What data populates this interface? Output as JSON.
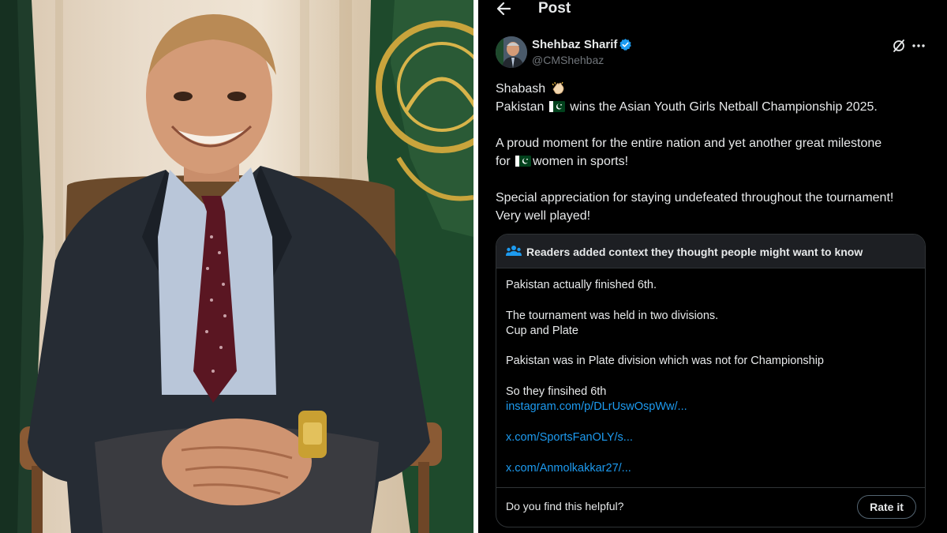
{
  "topbar": {
    "title": "Post"
  },
  "author": {
    "name": "Shehbaz Sharif",
    "handle": "@CMShehbaz"
  },
  "tweet": {
    "line1": "Shabash",
    "line2a": "Pakistan",
    "line2b": "wins the Asian Youth Girls Netball Championship 2025.",
    "line3": "A proud moment for the entire nation and yet another great milestone",
    "line4a": "for",
    "line4b": "women in sports!",
    "line5": "Special appreciation for staying undefeated throughout the tournament!",
    "line6": "Very well played!"
  },
  "community_note": {
    "title": "Readers added context they thought people might want to know",
    "line1": "Pakistan actually finished 6th.",
    "line2": "The tournament was held in two divisions.",
    "line3": "Cup and Plate",
    "line4": "Pakistan was in Plate division which was not for Championship",
    "line5": "So they finsihed 6th",
    "link1": "instagram.com/p/DLrUswOspWw/...",
    "link2": "x.com/SportsFanOLY/s...",
    "link3": "x.com/Anmolkakkar27/...",
    "helpful_prompt": "Do you find this helpful?",
    "rate_button": "Rate it"
  },
  "colors": {
    "background": "#000000",
    "text": "#e7e9ea",
    "muted": "#71767b",
    "link": "#1d9bf0",
    "border": "#2f3336",
    "verified": "#1d9bf0"
  },
  "icons": [
    "back-arrow-icon",
    "verified-badge-icon",
    "grok-icon",
    "more-icon",
    "people-icon",
    "clapping-hands-icon",
    "pakistan-flag-icon"
  ]
}
